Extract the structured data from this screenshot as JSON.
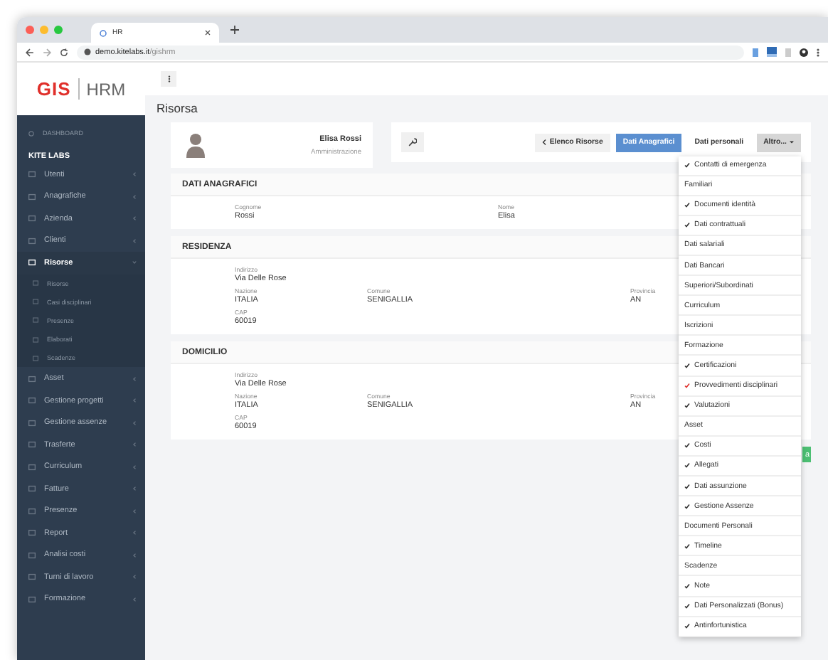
{
  "browser": {
    "tab_title": "HR",
    "url_host": "demo.kitelabs.it",
    "url_path": "/gishrm"
  },
  "logo": {
    "brand": "GIS",
    "product": "HRM"
  },
  "sidebar": {
    "dashboard": "DASHBOARD",
    "section": "KITE LABS",
    "items": [
      {
        "label": "Utenti",
        "selected": false
      },
      {
        "label": "Anagrafiche",
        "selected": false
      },
      {
        "label": "Azienda",
        "selected": false
      },
      {
        "label": "Clienti",
        "selected": false
      },
      {
        "label": "Risorse",
        "selected": true,
        "expanded": true,
        "children": [
          {
            "label": "Risorse"
          },
          {
            "label": "Casi disciplinari"
          },
          {
            "label": "Presenze"
          },
          {
            "label": "Elaborati"
          },
          {
            "label": "Scadenze"
          }
        ]
      },
      {
        "label": "Asset",
        "selected": false
      },
      {
        "label": "Gestione progetti",
        "selected": false
      },
      {
        "label": "Gestione assenze",
        "selected": false
      },
      {
        "label": "Trasferte",
        "selected": false
      },
      {
        "label": "Curriculum",
        "selected": false
      },
      {
        "label": "Fatture",
        "selected": false
      },
      {
        "label": "Presenze",
        "selected": false
      },
      {
        "label": "Report",
        "selected": false
      },
      {
        "label": "Analisi costi",
        "selected": false
      },
      {
        "label": "Turni di lavoro",
        "selected": false
      },
      {
        "label": "Formazione",
        "selected": false
      }
    ]
  },
  "page_title": "Risorsa",
  "profile": {
    "name": "Elisa Rossi",
    "role": "Amministrazione"
  },
  "actions": [
    {
      "kind": "back",
      "label": "Elenco Risorse"
    },
    {
      "kind": "tab",
      "label": "Dati Anagrafici",
      "selected": true
    },
    {
      "kind": "tab",
      "label": "Dati personali",
      "selected": false
    },
    {
      "kind": "menu",
      "label": "Altro...",
      "expanded": true
    }
  ],
  "menu": {
    "items": [
      {
        "label": "Contatti di emergenza",
        "checked": true,
        "color": "#333333"
      },
      {
        "label": "Familiari",
        "checked": false
      },
      {
        "label": "Documenti identità",
        "checked": true,
        "color": "#333333"
      },
      {
        "label": "Dati contrattuali",
        "checked": true,
        "color": "#333333"
      },
      {
        "label": "Dati salariali",
        "checked": false
      },
      {
        "label": "Dati Bancari",
        "checked": false
      },
      {
        "label": "Superiori/Subordinati",
        "checked": false
      },
      {
        "label": "Curriculum",
        "checked": false
      },
      {
        "label": "Iscrizioni",
        "checked": false
      },
      {
        "label": "Formazione",
        "checked": false
      },
      {
        "label": "Certificazioni",
        "checked": true,
        "color": "#333333"
      },
      {
        "label": "Provvedimenti disciplinari",
        "checked": true,
        "color": "#e0332f"
      },
      {
        "label": "Valutazioni",
        "checked": true,
        "color": "#333333"
      },
      {
        "label": "Asset",
        "checked": false
      },
      {
        "label": "Costi",
        "checked": true,
        "color": "#333333"
      },
      {
        "label": "Allegati",
        "checked": true,
        "color": "#333333"
      },
      {
        "label": "Dati assunzione",
        "checked": true,
        "color": "#333333"
      },
      {
        "label": "Gestione Assenze",
        "checked": true,
        "color": "#333333"
      },
      {
        "label": "Documenti Personali",
        "checked": false
      },
      {
        "label": "Timeline",
        "checked": true,
        "color": "#333333"
      },
      {
        "label": "Scadenze",
        "checked": false
      },
      {
        "label": "Note",
        "checked": true,
        "color": "#333333"
      },
      {
        "label": "Dati Personalizzati (Bonus)",
        "checked": true,
        "color": "#333333"
      },
      {
        "label": "Antinfortunistica",
        "checked": true,
        "color": "#333333"
      }
    ]
  },
  "sections": [
    {
      "title": "DATI ANAGRAFICI",
      "kind": "personal",
      "rows": [
        [
          {
            "label": "Cognome",
            "value": "Rossi"
          },
          {
            "label": "Nome",
            "value": "Elisa"
          }
        ]
      ]
    },
    {
      "title": "RESIDENZA",
      "kind": "address",
      "rows": [
        [
          {
            "label": "Indirizzo",
            "value": "Via Delle Rose"
          }
        ],
        [
          {
            "label": "Nazione",
            "value": "ITALIA"
          },
          {
            "label": "Comune",
            "value": "SENIGALLIA"
          },
          {
            "label": "Provincia",
            "value": "AN"
          }
        ],
        [
          {
            "label": "CAP",
            "value": "60019"
          }
        ]
      ]
    },
    {
      "title": "DOMICILIO",
      "kind": "address",
      "rows": [
        [
          {
            "label": "Indirizzo",
            "value": "Via Delle Rose"
          }
        ],
        [
          {
            "label": "Nazione",
            "value": "ITALIA"
          },
          {
            "label": "Comune",
            "value": "SENIGALLIA"
          },
          {
            "label": "Provincia",
            "value": "AN"
          }
        ],
        [
          {
            "label": "CAP",
            "value": "60019"
          }
        ]
      ]
    }
  ],
  "save_button": {
    "label": "a"
  }
}
